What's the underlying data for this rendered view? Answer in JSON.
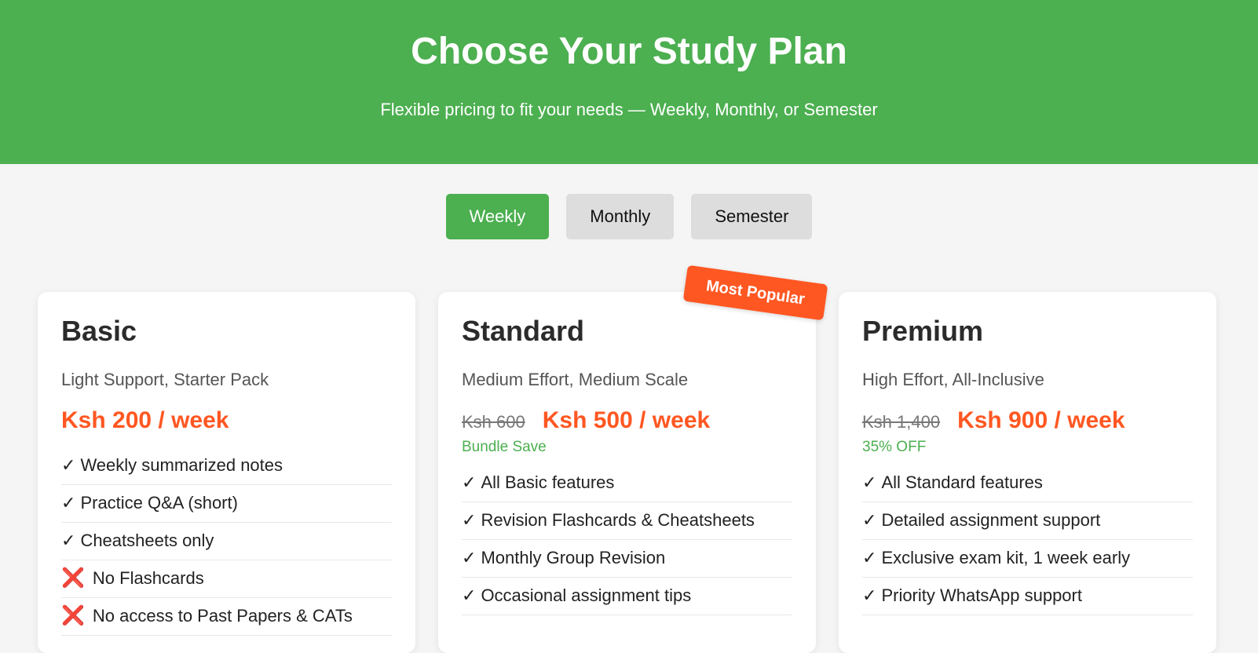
{
  "header": {
    "title": "Choose Your Study Plan",
    "subtitle": "Flexible pricing to fit your needs — Weekly, Monthly, or Semester"
  },
  "billing_toggle": {
    "options": [
      "Weekly",
      "Monthly",
      "Semester"
    ],
    "selected": "Weekly"
  },
  "colors": {
    "accent_green": "#4caf50",
    "price_orange": "#ff5722",
    "cross_red": "#e53960"
  },
  "plans": [
    {
      "name": "Basic",
      "tagline": "Light Support, Starter Pack",
      "old_price": "",
      "price": "Ksh 200 / week",
      "note": "",
      "features": [
        {
          "mark": "✓",
          "text": "Weekly summarized notes"
        },
        {
          "mark": "✓",
          "text": "Practice Q&A (short)"
        },
        {
          "mark": "✓",
          "text": "Cheatsheets only"
        },
        {
          "mark": "❌",
          "text": "No Flashcards"
        },
        {
          "mark": "❌",
          "text": "No access to Past Papers & CATs"
        }
      ]
    },
    {
      "name": "Standard",
      "badge": "Most Popular",
      "tagline": "Medium Effort, Medium Scale",
      "old_price": "Ksh 600",
      "price": "Ksh 500 / week",
      "note": "Bundle Save",
      "features": [
        {
          "mark": "✓",
          "text": "All Basic features"
        },
        {
          "mark": "✓",
          "text": "Revision Flashcards & Cheatsheets"
        },
        {
          "mark": "✓",
          "text": "Monthly Group Revision"
        },
        {
          "mark": "✓",
          "text": "Occasional assignment tips"
        }
      ]
    },
    {
      "name": "Premium",
      "tagline": "High Effort, All-Inclusive",
      "old_price": "Ksh 1,400",
      "price": "Ksh 900 / week",
      "note": "35% OFF",
      "features": [
        {
          "mark": "✓",
          "text": "All Standard features"
        },
        {
          "mark": "✓",
          "text": "Detailed assignment support"
        },
        {
          "mark": "✓",
          "text": "Exclusive exam kit, 1 week early"
        },
        {
          "mark": "✓",
          "text": "Priority WhatsApp support"
        }
      ]
    }
  ]
}
